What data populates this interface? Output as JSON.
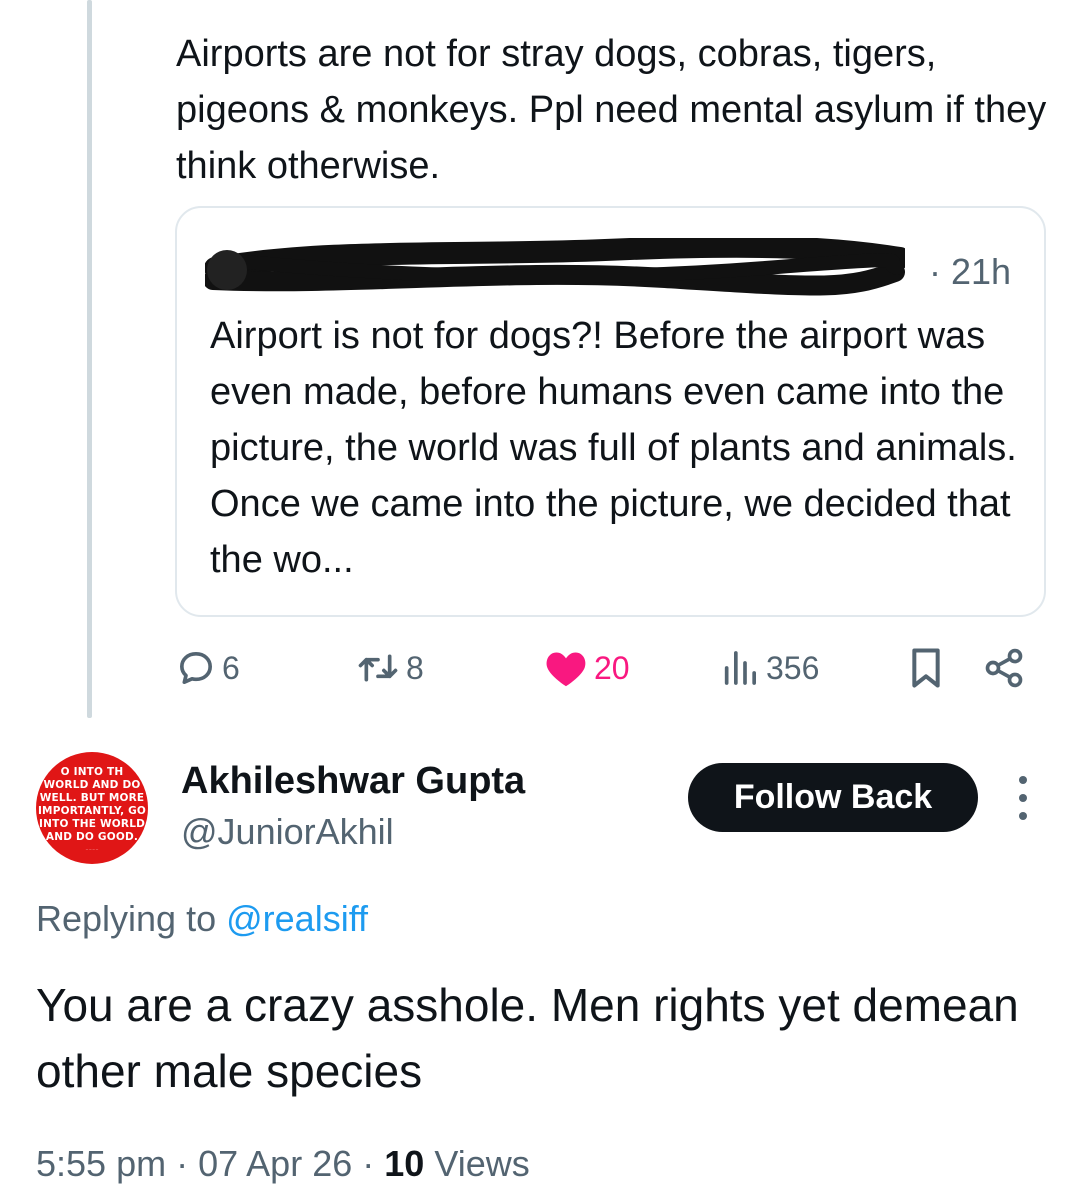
{
  "parent_tweet": {
    "text": "Airports are not for stray dogs, cobras, tigers, pigeons & monkeys. Ppl need mental asylum if they think otherwise.",
    "quoted": {
      "time": "21h",
      "text": "Airport is not for dogs?! Before the airport was even made, before humans even came into the picture, the world was full of plants and animals. Once we came into the picture, we decided that the wo..."
    },
    "actions": {
      "replies": "6",
      "retweets": "8",
      "likes": "20",
      "views": "356"
    }
  },
  "reply": {
    "avatar_text": [
      "O INTO TH",
      "WORLD AND DO",
      "WELL. BUT MORE",
      "IMPORTANTLY, GO",
      "INTO THE WORLD",
      "AND DO GOOD."
    ],
    "author_name": "Akhileshwar Gupta",
    "author_handle": "@JuniorAkhil",
    "follow_label": "Follow Back",
    "replying_prefix": "Replying to",
    "replying_to": "@realsiff",
    "text": "You are a crazy asshole. Men rights yet demean other male species",
    "time": "5:55 pm",
    "date": "07 Apr 26",
    "views_count": "10",
    "views_label": "Views",
    "separator": "·"
  },
  "colors": {
    "text_primary": "#0f1419",
    "text_secondary": "#536471",
    "like_pink": "#f91880",
    "link_blue": "#1d9bf0",
    "avatar_red": "#e01616",
    "button_dark": "#0f1419"
  },
  "icons": [
    "reply-icon",
    "retweet-icon",
    "heart-icon",
    "views-icon",
    "bookmark-icon",
    "share-icon",
    "more-icon"
  ]
}
